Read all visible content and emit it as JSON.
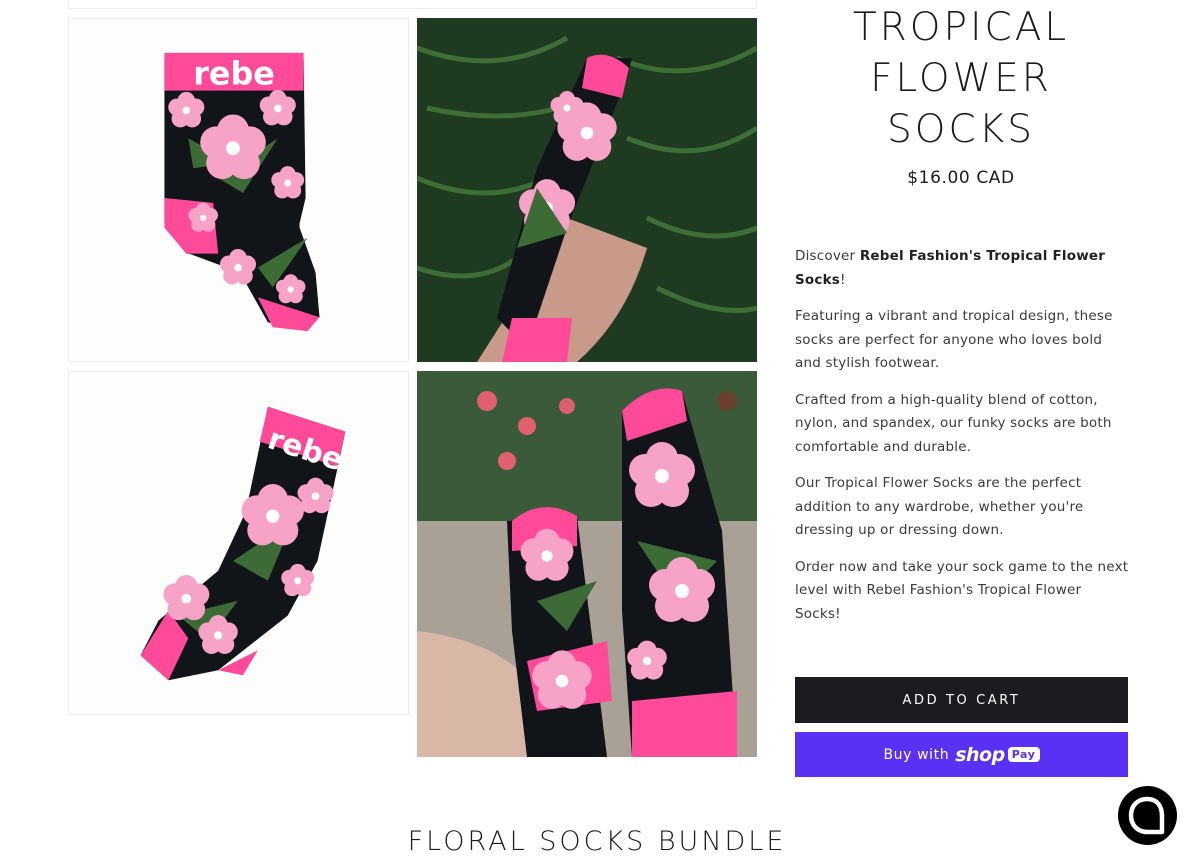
{
  "product": {
    "title_lines": [
      "TROPICAL",
      "FLOWER",
      "SOCKS"
    ],
    "price": "$16.00 CAD",
    "description": {
      "intro_prefix": "Discover ",
      "intro_bold": "Rebel Fashion's Tropical Flower Socks",
      "intro_suffix": "!",
      "paragraphs": [
        "Featuring a vibrant and tropical design, these socks are perfect for anyone who loves bold and stylish footwear.",
        "Crafted from a high-quality blend of cotton, nylon, and spandex, our funky socks are both comfortable and durable.",
        "Our Tropical Flower Socks are the perfect addition to any wardrobe, whether you're dressing up or dressing down.",
        "Order now and take your sock game to the next level with Rebel Fashion's Tropical Flower Socks!"
      ]
    }
  },
  "gallery": {
    "sock_brand_text": "rebe",
    "images": [
      {
        "icon": "product-photo-flat-pair"
      },
      {
        "icon": "product-photo-legs-ferns"
      },
      {
        "icon": "product-photo-flat-single"
      },
      {
        "icon": "product-photo-legs-deck"
      }
    ]
  },
  "buttons": {
    "add_to_cart": "ADD TO CART",
    "buy_with": "Buy with",
    "shop_logo": "shop",
    "pay_badge": "Pay"
  },
  "related": {
    "heading": "FLORAL SOCKS BUNDLE"
  },
  "chat": {
    "icon": "chat-bubble-icon"
  },
  "colors": {
    "accent_pink": "#ff4a9a",
    "flower_pink": "#f7a3c8",
    "sock_black": "#111418",
    "cart_button": "#1a1c1f",
    "shop_pay": "#5a31f4"
  }
}
